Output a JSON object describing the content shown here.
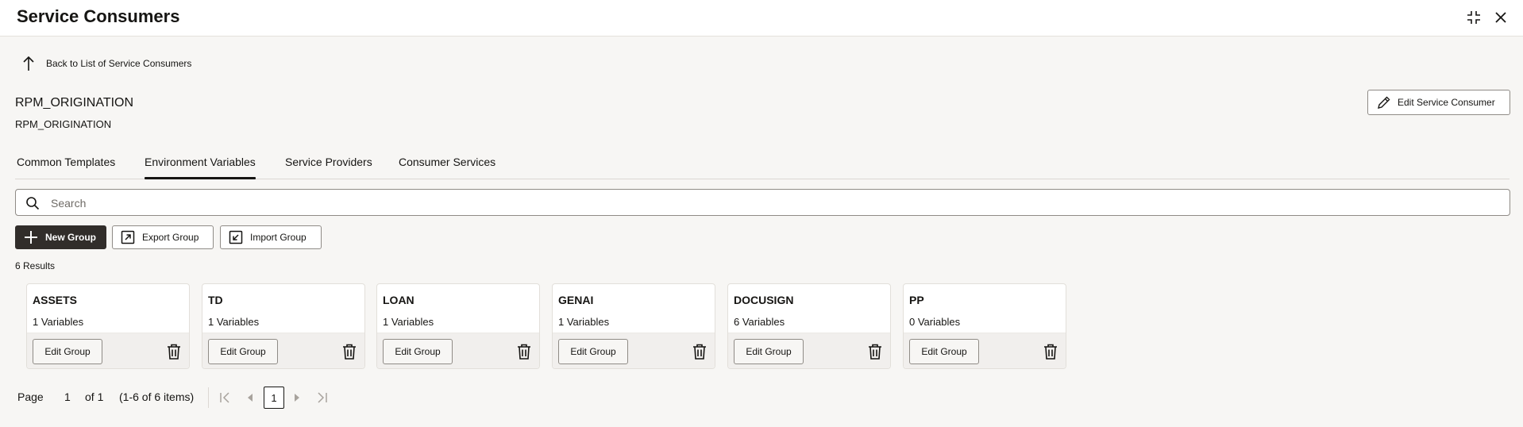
{
  "window": {
    "title": "Service Consumers",
    "restore_icon": "collapse-arrows-icon",
    "close_icon": "close-icon"
  },
  "back_link": {
    "label": "Back to List of Service Consumers",
    "icon": "arrow-up-icon"
  },
  "consumer": {
    "name": "RPM_ORIGINATION",
    "subtitle": "RPM_ORIGINATION",
    "edit_label": "Edit Service Consumer",
    "edit_icon": "pencil-icon"
  },
  "tabs": [
    {
      "label": "Common Templates",
      "active": false
    },
    {
      "label": "Environment Variables",
      "active": true
    },
    {
      "label": "Service Providers",
      "active": false
    },
    {
      "label": "Consumer Services",
      "active": false
    }
  ],
  "search": {
    "placeholder": "Search",
    "value": "",
    "icon": "search-icon"
  },
  "toolbar": {
    "new_group": "New Group",
    "export_group": "Export Group",
    "import_group": "Import Group"
  },
  "results_count": "6 Results",
  "groups": [
    {
      "name": "ASSETS",
      "variables": "1 Variables",
      "edit_label": "Edit Group"
    },
    {
      "name": "TD",
      "variables": "1 Variables",
      "edit_label": "Edit Group"
    },
    {
      "name": "LOAN",
      "variables": "1 Variables",
      "edit_label": "Edit Group"
    },
    {
      "name": "GENAI",
      "variables": "1 Variables",
      "edit_label": "Edit Group"
    },
    {
      "name": "DOCUSIGN",
      "variables": "6 Variables",
      "edit_label": "Edit Group"
    },
    {
      "name": "PP",
      "variables": "0 Variables",
      "edit_label": "Edit Group"
    }
  ],
  "pagination": {
    "page_label": "Page",
    "current_page": "1",
    "of_label": "of 1",
    "range_label": "(1-6 of 6 items)",
    "page_button": "1"
  },
  "colors": {
    "background": "#f7f6f4",
    "primary_button": "#312d2a",
    "border": "#8f8b86",
    "text": "#161513"
  }
}
